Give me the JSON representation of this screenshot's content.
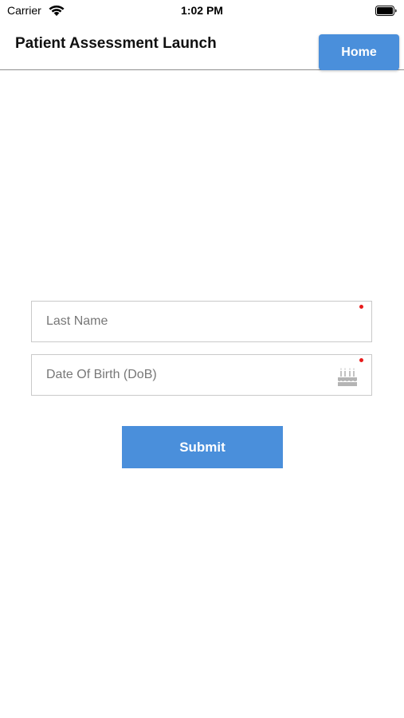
{
  "status_bar": {
    "carrier": "Carrier",
    "time": "1:02 PM"
  },
  "header": {
    "title": "Patient Assessment Launch",
    "home_label": "Home"
  },
  "form": {
    "last_name": {
      "placeholder": "Last Name",
      "value": "",
      "required": true
    },
    "dob": {
      "placeholder": "Date Of Birth (DoB)",
      "value": "",
      "required": true,
      "icon": "birthday-cake-icon"
    },
    "submit_label": "Submit"
  },
  "colors": {
    "accent": "#4a8fdb",
    "required": "#e81b1b",
    "divider": "#8f8f8f"
  }
}
